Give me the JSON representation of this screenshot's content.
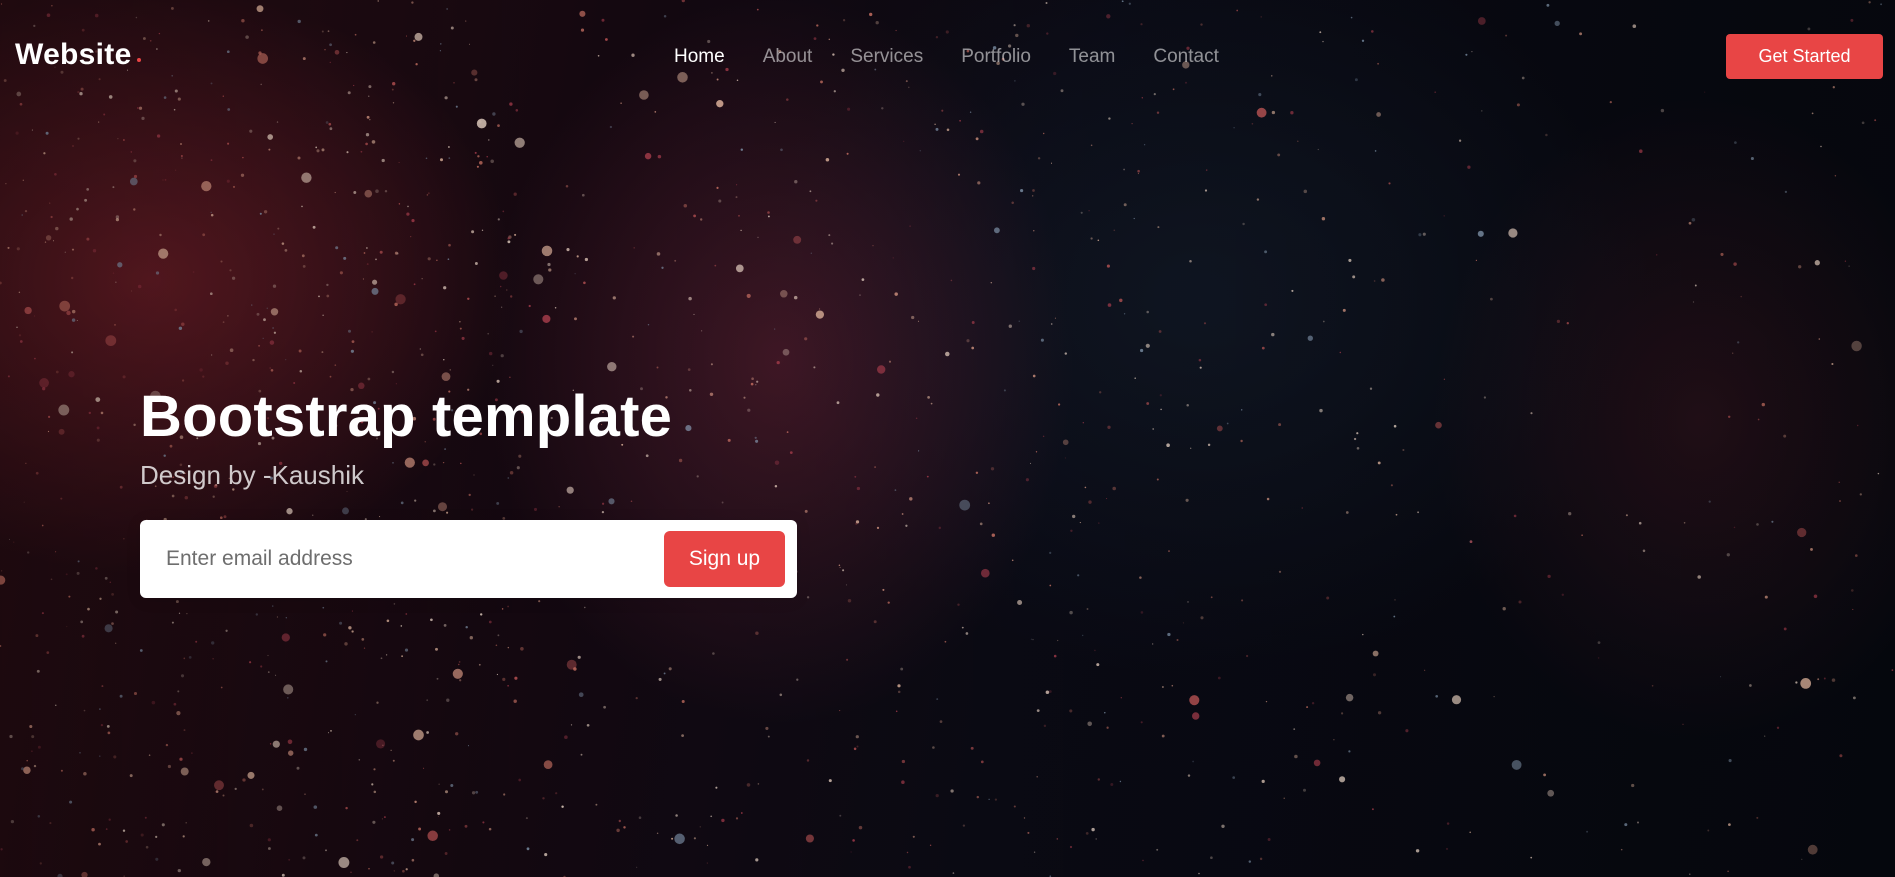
{
  "header": {
    "logo_text": "Website",
    "nav": [
      {
        "label": "Home",
        "active": true
      },
      {
        "label": "About",
        "active": false
      },
      {
        "label": "Services",
        "active": false
      },
      {
        "label": "Portfolio",
        "active": false
      },
      {
        "label": "Team",
        "active": false
      },
      {
        "label": "Contact",
        "active": false
      }
    ],
    "cta_label": "Get Started"
  },
  "hero": {
    "title": "Bootstrap template",
    "subtitle": "Design by -Kaushik",
    "email_placeholder": "Enter email address",
    "email_value": "",
    "signup_label": "Sign up"
  },
  "colors": {
    "accent": "#e84545",
    "text_primary": "#ffffff",
    "background": "#07070d"
  }
}
